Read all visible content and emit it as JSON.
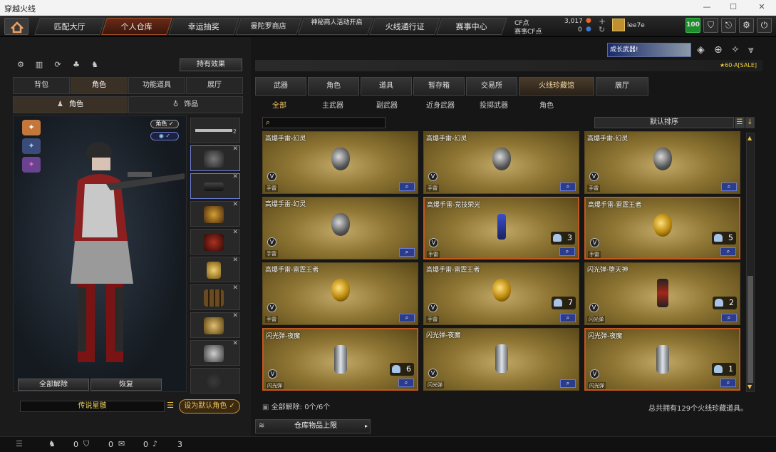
{
  "window": {
    "title": "穿越火线"
  },
  "nav": {
    "tabs": [
      "匹配大厅",
      "个人仓库",
      "幸运抽奖",
      "曼陀罗商店",
      "神秘商人活动开启",
      "火线通行证",
      "赛事中心"
    ],
    "active_index": 1
  },
  "currency": {
    "cf_label": "CF点",
    "cf_value": "3,017",
    "event_label": "赛事CF点",
    "event_value": "0"
  },
  "user": {
    "name": "lee7e",
    "level": "100"
  },
  "promo": {
    "banner": "成长武器!",
    "rank_text": "★60-A[SALE]"
  },
  "left": {
    "effect_button": "持有效果",
    "tabs": [
      "背包",
      "角色",
      "功能道具",
      "展厅"
    ],
    "active_tab": 1,
    "subtabs": [
      "角色",
      "饰品"
    ],
    "active_subtab": 0,
    "toggle_role": "角色",
    "unequip_all": "全部解除",
    "restore": "恢复",
    "character_name": "传说星骸",
    "set_default": "设为默认角色"
  },
  "right": {
    "tabs": [
      "武器",
      "角色",
      "道具",
      "暂存箱",
      "交易所",
      "火线珍藏馆",
      "展厅"
    ],
    "active_tab": 5,
    "subtabs": [
      "全部",
      "主武器",
      "副武器",
      "近身武器",
      "投掷武器",
      "角色"
    ],
    "active_subtab": 0,
    "search_placeholder": "",
    "sort_label": "默认排序",
    "items": [
      {
        "name": "高爆手雷-幻灵",
        "type": "手雷",
        "count": "",
        "rarity": "normal",
        "art": "dark"
      },
      {
        "name": "高爆手雷-幻灵",
        "type": "手雷",
        "count": "",
        "rarity": "normal",
        "art": "dark"
      },
      {
        "name": "高爆手雷-幻灵",
        "type": "手雷",
        "count": "",
        "rarity": "normal",
        "art": "dark"
      },
      {
        "name": "高爆手雷-幻灵",
        "type": "手雷",
        "count": "",
        "rarity": "normal",
        "art": "dark"
      },
      {
        "name": "高爆手雷-竞技荣光",
        "type": "手雷",
        "count": "3",
        "rarity": "epic",
        "art": "blue"
      },
      {
        "name": "高爆手雷-雷霆王者",
        "type": "手雷",
        "count": "5",
        "rarity": "epic",
        "art": "gold"
      },
      {
        "name": "高爆手雷-雷霆王者",
        "type": "手雷",
        "count": "",
        "rarity": "normal",
        "art": "gold"
      },
      {
        "name": "高爆手雷-雷霆王者",
        "type": "手雷",
        "count": "7",
        "rarity": "normal",
        "art": "gold"
      },
      {
        "name": "闪光弹-堕天神",
        "type": "闪光弹",
        "count": "2",
        "rarity": "normal",
        "art": "red"
      },
      {
        "name": "闪光弹-夜魔",
        "type": "闪光弹",
        "count": "6",
        "rarity": "epic",
        "art": "silver"
      },
      {
        "name": "闪光弹-夜魔",
        "type": "闪光弹",
        "count": "",
        "rarity": "normal",
        "art": "silver"
      },
      {
        "name": "闪光弹-夜魔",
        "type": "闪光弹",
        "count": "1",
        "rarity": "epic",
        "art": "silver"
      }
    ],
    "unequip_label": "全部解除:",
    "unequip_count": "0个/6个",
    "total_text": "总共拥有129个火线珍藏道具。",
    "warehouse_limit": "仓库物品上限"
  },
  "bottom": {
    "counts": [
      "0",
      "0",
      "0",
      "3"
    ]
  }
}
